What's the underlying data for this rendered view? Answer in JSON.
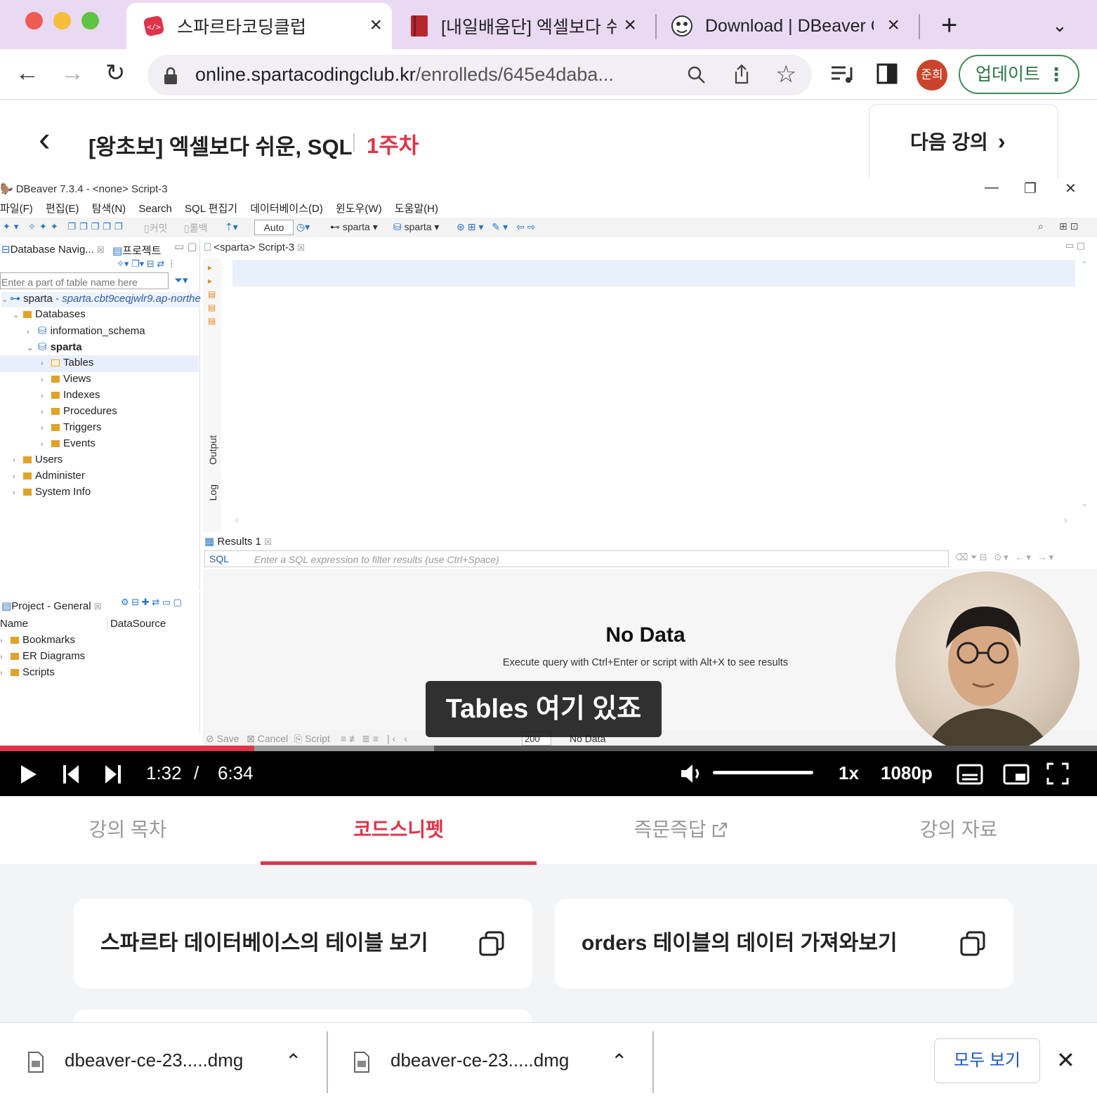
{
  "browser": {
    "tabs": [
      {
        "title": "스파르타코딩클럽",
        "icon": "sparta-logo-icon",
        "active": true
      },
      {
        "title": "[내일배움단] 엑셀보다 쉬운",
        "icon": "book-icon",
        "active": false
      },
      {
        "title": "Download | DBeaver C",
        "icon": "dbeaver-beaver-icon",
        "active": false
      }
    ],
    "url_host": "online.spartacodingclub.kr",
    "url_path": "/enrolleds/645e4daba...",
    "profile_initials": "준희",
    "update_label": "업데이트",
    "colors": {
      "tabstrip": "#e9d9f3",
      "accent": "#e0334a"
    }
  },
  "lecture": {
    "title": "[왕초보] 엑셀보다 쉬운, SQL",
    "week": "1주차",
    "next_label": "다음 강의"
  },
  "dbeaver": {
    "window_title": "DBeaver 7.3.4 - <none> Script-3",
    "menu": [
      "파일(F)",
      "편집(E)",
      "탐색(N)",
      "Search",
      "SQL 편집기",
      "데이터베이스(D)",
      "윈도우(W)",
      "도움말(H)"
    ],
    "toolbar": {
      "commit": "커밋",
      "rollback": "롤백",
      "mode": "Auto",
      "datasource": "sparta",
      "schema": "sparta"
    },
    "nav_tabs": [
      "Database Navig...",
      "프로젝트"
    ],
    "filter_placeholder": "Enter a part of table name here",
    "tree": {
      "connection": "sparta",
      "connection_host": "- sparta.cbt9ceqjwlr9.ap-northe",
      "databases": "Databases",
      "info_schema": "information_schema",
      "db": "sparta",
      "children": [
        "Tables",
        "Views",
        "Indexes",
        "Procedures",
        "Triggers",
        "Events"
      ],
      "others": [
        "Users",
        "Administer",
        "System Info"
      ]
    },
    "project": {
      "title": "Project - General",
      "col_name": "Name",
      "col_ds": "DataSource",
      "items": [
        "Bookmarks",
        "ER Diagrams",
        "Scripts"
      ]
    },
    "editor_tab": "<sparta> Script-3",
    "side_labels": {
      "output": "Output",
      "log": "Log"
    },
    "results_tab": "Results 1",
    "sql_tag": "SQL",
    "result_filter_placeholder": "Enter a SQL expression to filter results (use Ctrl+Space)",
    "nodata_title": "No Data",
    "nodata_sub": "Execute query with Ctrl+Enter or script with Alt+X to see results",
    "status": {
      "save": "Save",
      "cancel": "Cancel",
      "script": "Script",
      "fetch": "200",
      "state": "No Data"
    }
  },
  "video": {
    "subtitle": "Tables 여기 있죠",
    "current": "1:32",
    "divider": "/",
    "duration": "6:34",
    "progress_fraction": 0.232,
    "speed": "1x",
    "quality": "1080p"
  },
  "lecture_tabs": [
    "강의 목차",
    "코드스니펫",
    "즉문즉답",
    "강의 자료"
  ],
  "snippets": [
    "스파르타 데이터베이스의 테이블 보기",
    "orders 테이블의 데이터 가져와보기"
  ],
  "downloads": {
    "items": [
      "dbeaver-ce-23.....dmg",
      "dbeaver-ce-23.....dmg"
    ],
    "show_all": "모두 보기"
  }
}
